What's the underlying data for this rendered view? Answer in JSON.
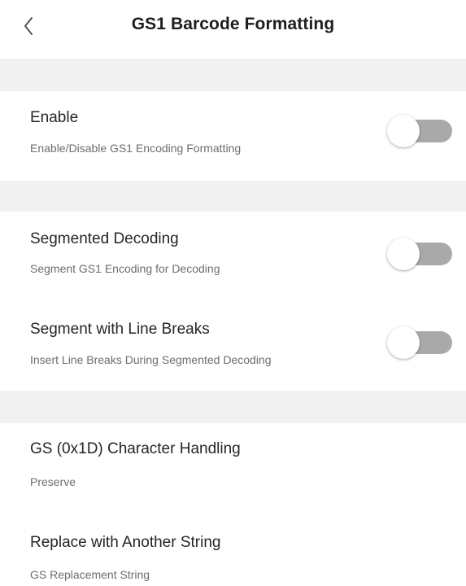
{
  "header": {
    "title": "GS1 Barcode Formatting",
    "back_icon": "chevron-left-icon"
  },
  "settings": {
    "enable": {
      "title": "Enable",
      "subtitle": "Enable/Disable GS1 Encoding Formatting",
      "on": false
    },
    "segmented_decoding": {
      "title": "Segmented Decoding",
      "subtitle": "Segment GS1 Encoding for Decoding",
      "on": false
    },
    "line_breaks": {
      "title": "Segment with Line Breaks",
      "subtitle": "Insert Line Breaks During Segmented Decoding",
      "on": false
    },
    "gs_handling": {
      "title": "GS (0x1D) Character Handling",
      "value": "Preserve"
    },
    "replace_string": {
      "title": "Replace with Another String",
      "subtitle": "GS Replacement String"
    }
  },
  "colors": {
    "toggle_track_off": "#a9a9a9",
    "toggle_knob": "#ffffff",
    "section_band": "#f1f1f1"
  }
}
